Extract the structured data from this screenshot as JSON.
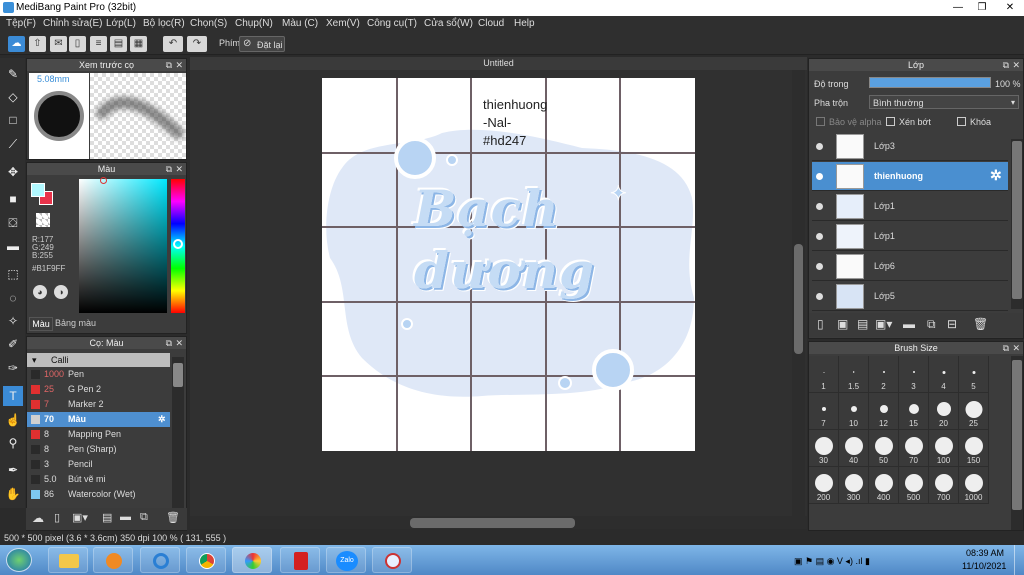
{
  "window": {
    "title": "MediBang Paint Pro (32bit)"
  },
  "menu": [
    "Tệp(F)",
    "Chỉnh sửa(E)",
    "Lớp(L)",
    "Bộ lọc(R)",
    "Chọn(S)",
    "Chụp(N)",
    "Màu (C)",
    "Xem(V)",
    "Công cụ(T)",
    "Cửa sổ(W)",
    "Cloud",
    "Help"
  ],
  "toolbar": {
    "shortcut_label": "Phím",
    "reset_label": "Đặt lại"
  },
  "brush_preview": {
    "title": "Xem trước cọ",
    "size": "5.08mm"
  },
  "color_panel": {
    "title": "Màu",
    "r": "R:177",
    "g": "G:249",
    "b": "B:255",
    "hex": "#B1F9FF",
    "tab_color": "Màu",
    "tab_palette": "Bảng màu",
    "primary": "#B1F9FF",
    "secondary": "#e8334a"
  },
  "brush_panel": {
    "title": "Cọ: Màu",
    "group": "Calli",
    "items": [
      {
        "size": "1000",
        "name": "Pen",
        "color": "#2a2a2a"
      },
      {
        "size": "25",
        "name": "G Pen 2",
        "color": "#e03030"
      },
      {
        "size": "7",
        "name": "Marker 2",
        "color": "#e03030"
      },
      {
        "size": "70",
        "name": "Màu",
        "color": "#d0d0d0"
      },
      {
        "size": "8",
        "name": "Mapping Pen",
        "color": "#e03030"
      },
      {
        "size": "8",
        "name": "Pen (Sharp)",
        "color": "#2a2a2a"
      },
      {
        "size": "3",
        "name": "Pencil",
        "color": "#2a2a2a"
      },
      {
        "size": "5.0",
        "name": "Bút vẽ mi",
        "color": "#2a2a2a"
      },
      {
        "size": "86",
        "name": "Watercolor (Wet)",
        "color": "#7ec8f0"
      }
    ]
  },
  "canvas": {
    "tab_title": "Untitled",
    "text_lines": [
      "thienhuong",
      "-Nal-",
      "#hd247"
    ],
    "lettering": "Bạch dương"
  },
  "layer_panel": {
    "title": "Lớp",
    "opacity_label": "Độ trong",
    "opacity_value": "100 %",
    "blend_label": "Pha trộn",
    "blend_value": "Bình thường",
    "protect_alpha": "Bảo vệ alpha",
    "clipping": "Xén bớt",
    "lock": "Khóa",
    "layers": [
      "Lớp3",
      "thienhuong",
      "Lớp1",
      "Lớp1",
      "Lớp6",
      "Lớp5"
    ]
  },
  "brush_size": {
    "title": "Brush Size",
    "sizes": [
      "1",
      "1.5",
      "2",
      "3",
      "4",
      "5",
      "7",
      "10",
      "12",
      "15",
      "20",
      "25",
      "30",
      "40",
      "50",
      "70",
      "100",
      "150",
      "200",
      "300",
      "400",
      "500",
      "700",
      "1000"
    ]
  },
  "status": {
    "text": "500 * 500 pixel   (3.6 * 3.6cm)   350 dpi   100 %   ( 131, 555 )"
  },
  "taskbar": {
    "time": "08:39 AM",
    "date": "11/10/2021",
    "zalo": "Zalo"
  }
}
